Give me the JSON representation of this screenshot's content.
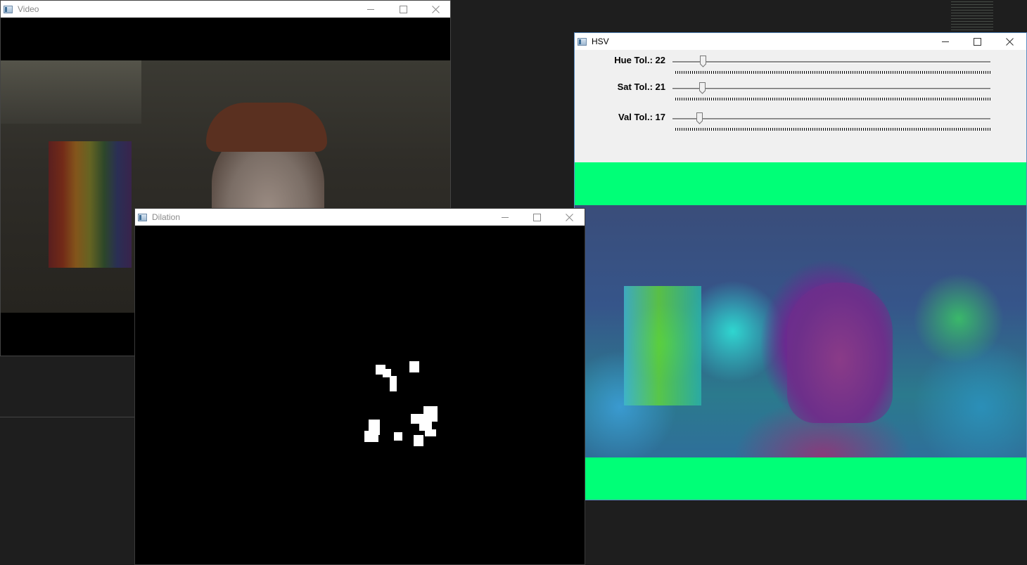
{
  "windows": {
    "video": {
      "title": "Video"
    },
    "dilation": {
      "title": "Dilation"
    },
    "hsv": {
      "title": "HSV",
      "trackbars": [
        {
          "label": "Hue Tol.: 22",
          "value": 22
        },
        {
          "label": "Sat Tol.: 21",
          "value": 21
        },
        {
          "label": "Val Tol.: 17",
          "value": 17
        }
      ]
    }
  },
  "colors": {
    "desktop": "#1e1e1e",
    "window_background": "#f0f0f0",
    "hsv_padding": "#00ff77",
    "mask_background": "#000000",
    "mask_foreground": "#ffffff"
  },
  "icons": [
    "window-app-icon",
    "minimize-icon",
    "maximize-icon",
    "close-icon"
  ]
}
